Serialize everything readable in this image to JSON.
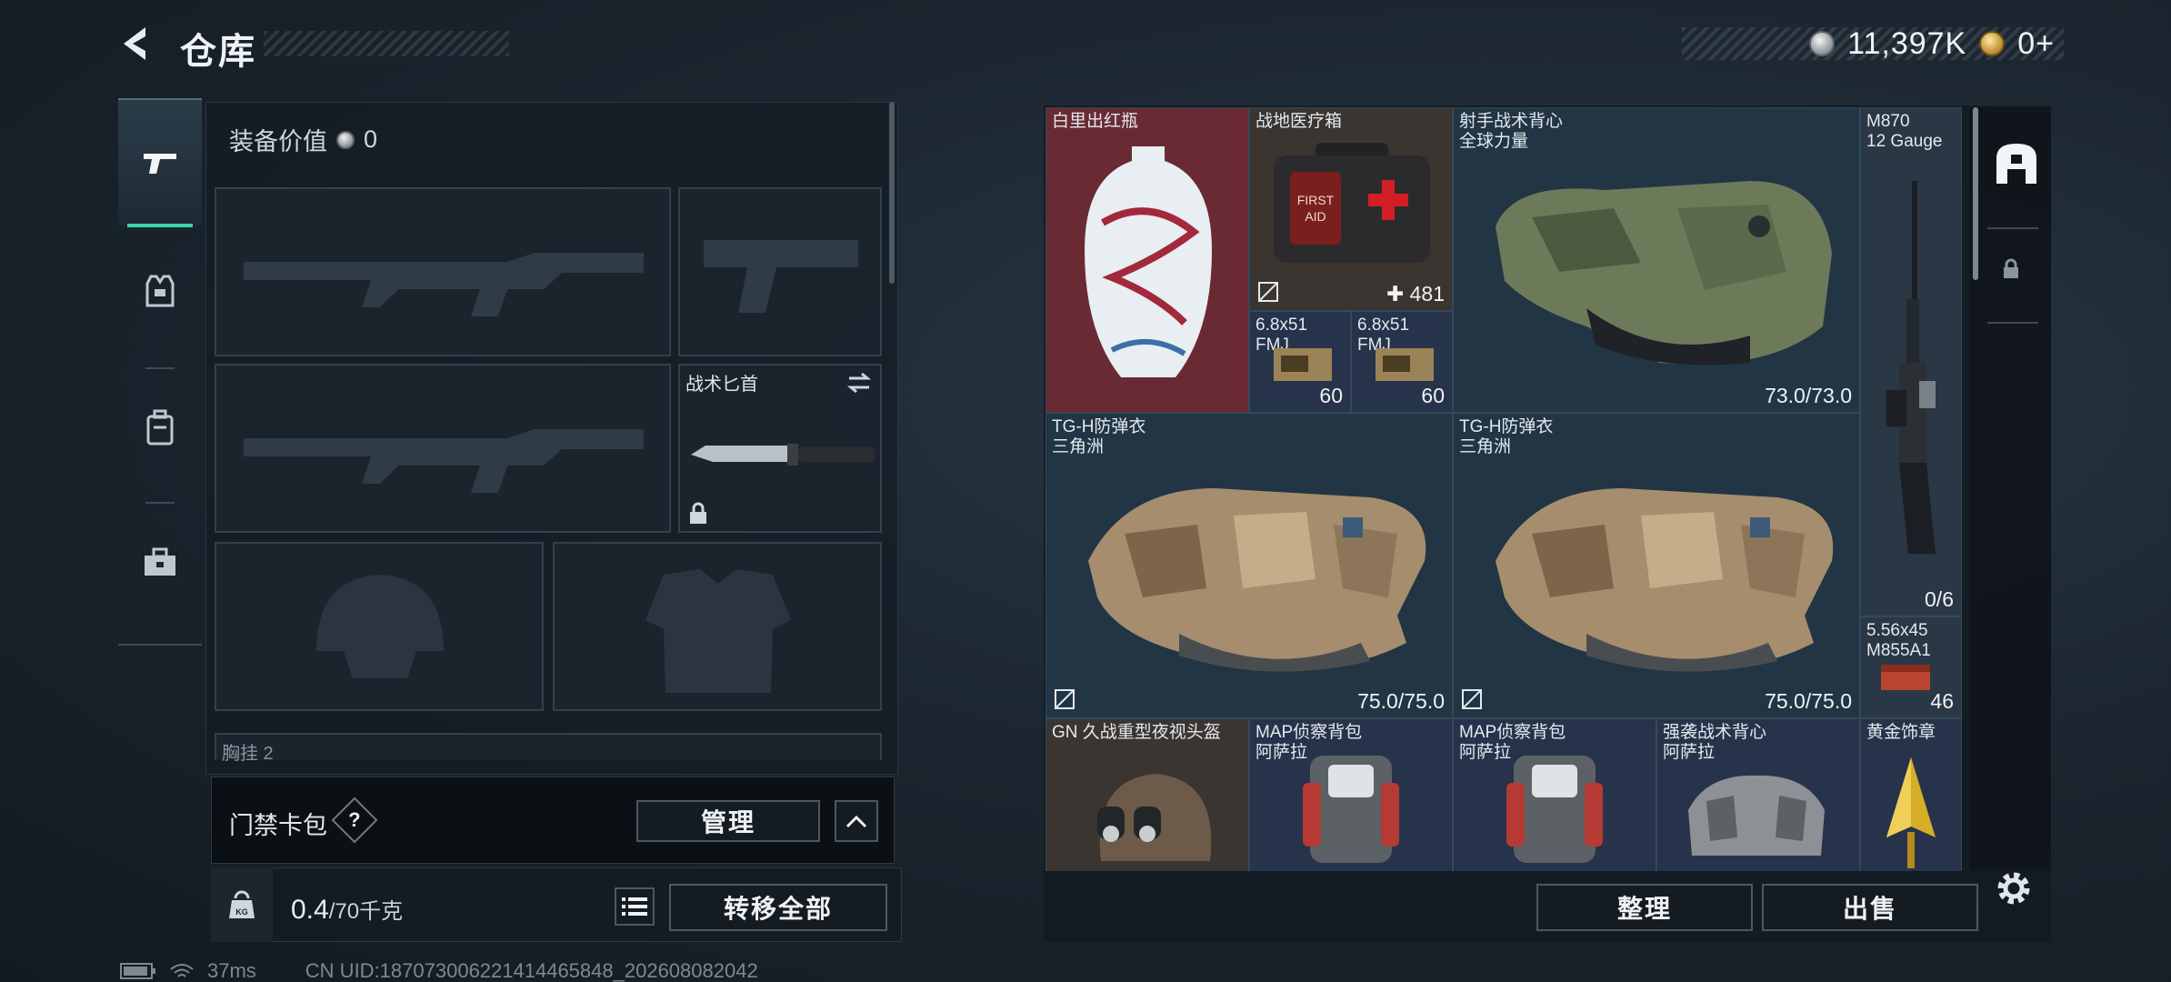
{
  "header": {
    "title": "仓库",
    "currency_main": "11,397K",
    "currency_premium": "0+"
  },
  "loadout": {
    "equip_value_label": "装备价值",
    "equip_value": "0",
    "knife_label": "战术匕首",
    "chest_rig_label_partial": "胸挂 2"
  },
  "keycard": {
    "label": "门禁卡包",
    "help": "?",
    "manage": "管理"
  },
  "weight": {
    "current": "0.4",
    "max": "/70千克"
  },
  "actions": {
    "transfer_all": "转移全部",
    "sort": "整理",
    "sell": "出售"
  },
  "status": {
    "ping": "37ms",
    "uid": "CN UID:187073006221414465848_202608082042"
  },
  "stash_items": [
    {
      "name": "白里出红瓶",
      "sub": "",
      "count": ""
    },
    {
      "name": "战地医疗箱",
      "sub": "",
      "count": "481"
    },
    {
      "name": "射手战术背心",
      "sub": "全球力量",
      "count": "73.0/73.0"
    },
    {
      "name": "M870",
      "sub": "12 Gauge",
      "count": "0/6"
    },
    {
      "name": "6.8x51",
      "sub": "FMJ",
      "count": "60"
    },
    {
      "name": "6.8x51",
      "sub": "FMJ",
      "count": "60"
    },
    {
      "name": "TG-H防弹衣",
      "sub": "三角洲",
      "count": "75.0/75.0"
    },
    {
      "name": "TG-H防弹衣",
      "sub": "三角洲",
      "count": "75.0/75.0"
    },
    {
      "name": "5.56x45",
      "sub": "M855A1",
      "count": "46"
    },
    {
      "name": "GN 久战重型夜视头盔",
      "sub": "",
      "count": ""
    },
    {
      "name": "MAP侦察背包",
      "sub": "阿萨拉",
      "count": ""
    },
    {
      "name": "MAP侦察背包",
      "sub": "阿萨拉",
      "count": ""
    },
    {
      "name": "强袭战术背心",
      "sub": "阿萨拉",
      "count": ""
    },
    {
      "name": "黄金饰章",
      "sub": "",
      "count": ""
    }
  ],
  "colors": {
    "accent_green": "#35d8a8",
    "rare_red": "#6a2a33",
    "cell_blue": "#223544"
  }
}
